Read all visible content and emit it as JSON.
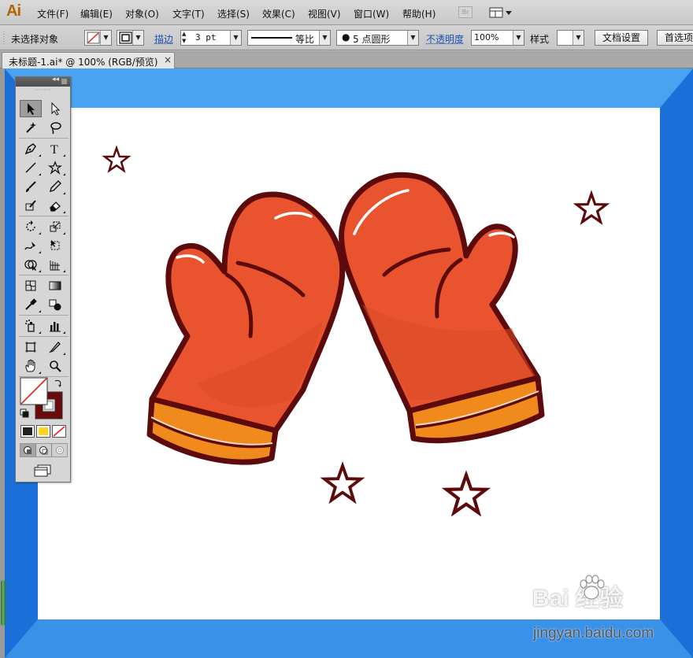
{
  "app": {
    "logo": "Ai"
  },
  "menu": {
    "items": [
      "文件(F)",
      "编辑(E)",
      "对象(O)",
      "文字(T)",
      "选择(S)",
      "效果(C)",
      "视图(V)",
      "窗口(W)",
      "帮助(H)"
    ],
    "bridge_label": "Br",
    "workspace_icon": "workspace-grid-icon"
  },
  "control": {
    "selection_status": "未选择对象",
    "stroke_label": "描边",
    "stroke_weight": "3 pt",
    "stroke_profile": "等比",
    "brush": "5 点圆形",
    "opacity_label": "不透明度",
    "opacity_value": "100%",
    "style_label": "样式",
    "doc_setup_button": "文档设置",
    "prefs_button": "首选项"
  },
  "document": {
    "tab_title": "未标题-1.ai* @ 100% (RGB/预览)",
    "close_glyph": "×"
  },
  "tools": {
    "panel_collapse_glyph": "◂◂",
    "items": [
      "selection",
      "direct-selection",
      "magic-wand",
      "lasso",
      "pen",
      "type",
      "line-segment",
      "star",
      "paintbrush",
      "pencil",
      "blob-brush",
      "eraser",
      "rotate",
      "scale",
      "warp",
      "free-transform",
      "shape-builder",
      "perspective-grid",
      "mesh",
      "gradient",
      "eyedropper",
      "blend",
      "symbol-sprayer",
      "column-graph",
      "artboard",
      "slice",
      "hand",
      "zoom"
    ]
  },
  "colors": {
    "artboard_blue": "#4aa3f0",
    "artboard_blue_dark": "#1a6fd8",
    "mitten_fill": "#e9542f",
    "mitten_outline": "#5c0a0a",
    "cuff_fill": "#f08a1c",
    "star_outline": "#5c0a0a",
    "stroke_swatch": "#6a0a0a",
    "fill_swatch": "#ffffff"
  },
  "watermark": {
    "brand": "Bai 经验",
    "url": "jingyan.baidu.com"
  }
}
